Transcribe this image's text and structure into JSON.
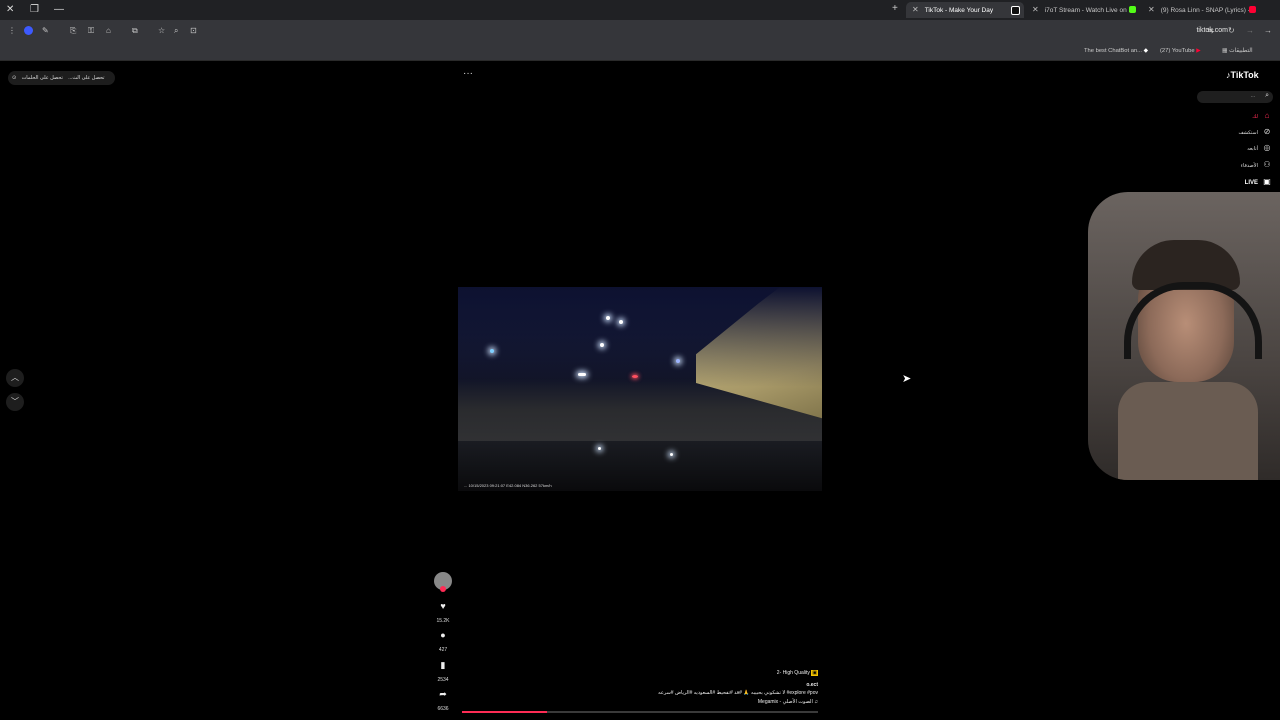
{
  "browser": {
    "tabs": [
      {
        "title": "TikTok - Make Your Day",
        "active": true,
        "favicon_color": "#111111"
      },
      {
        "title": "i7oT Stream - Watch Live on Ki",
        "active": false,
        "favicon_color": "#53fc18"
      },
      {
        "title": "(9) Rosa Linn - SNAP (Lyrics) - ",
        "active": false,
        "favicon_color": "#ff0033"
      }
    ],
    "url": "tiktok.com",
    "bookmarks": [
      "The best ChatBot an...",
      "(27) YouTube",
      "التطبيقات"
    ]
  },
  "page": {
    "top_pills": [
      "تحصل على الث...",
      "تحصل على الحلمات"
    ],
    "brand": "TikTok",
    "search_placeholder": "...",
    "nav": [
      {
        "label": "لك",
        "icon": "home-icon",
        "active": true
      },
      {
        "label": "استكشف",
        "icon": "explore-icon"
      },
      {
        "label": "أتابعه",
        "icon": "following-icon"
      },
      {
        "label": "الأصدقاء",
        "icon": "friends-icon"
      },
      {
        "label": "LIVE",
        "icon": "live-icon"
      }
    ],
    "video": {
      "timestamp_text": "...  10/15/2023 09:21:07  E42.084 N36.262  57km/h",
      "progress_fraction": 0.24
    },
    "actions": {
      "likes": "15.2K",
      "comments": "427",
      "saves": "2534",
      "shares": "6636"
    },
    "caption": {
      "badge": "2- High Quality",
      "author": "o.ect",
      "text": "لا تشكوني بحبيبه 🙏 #قد #تفحيط #السعوديه #الرياض #سرعه #explore #pov",
      "sound": "Megamix - الصوت الأصلي"
    }
  }
}
